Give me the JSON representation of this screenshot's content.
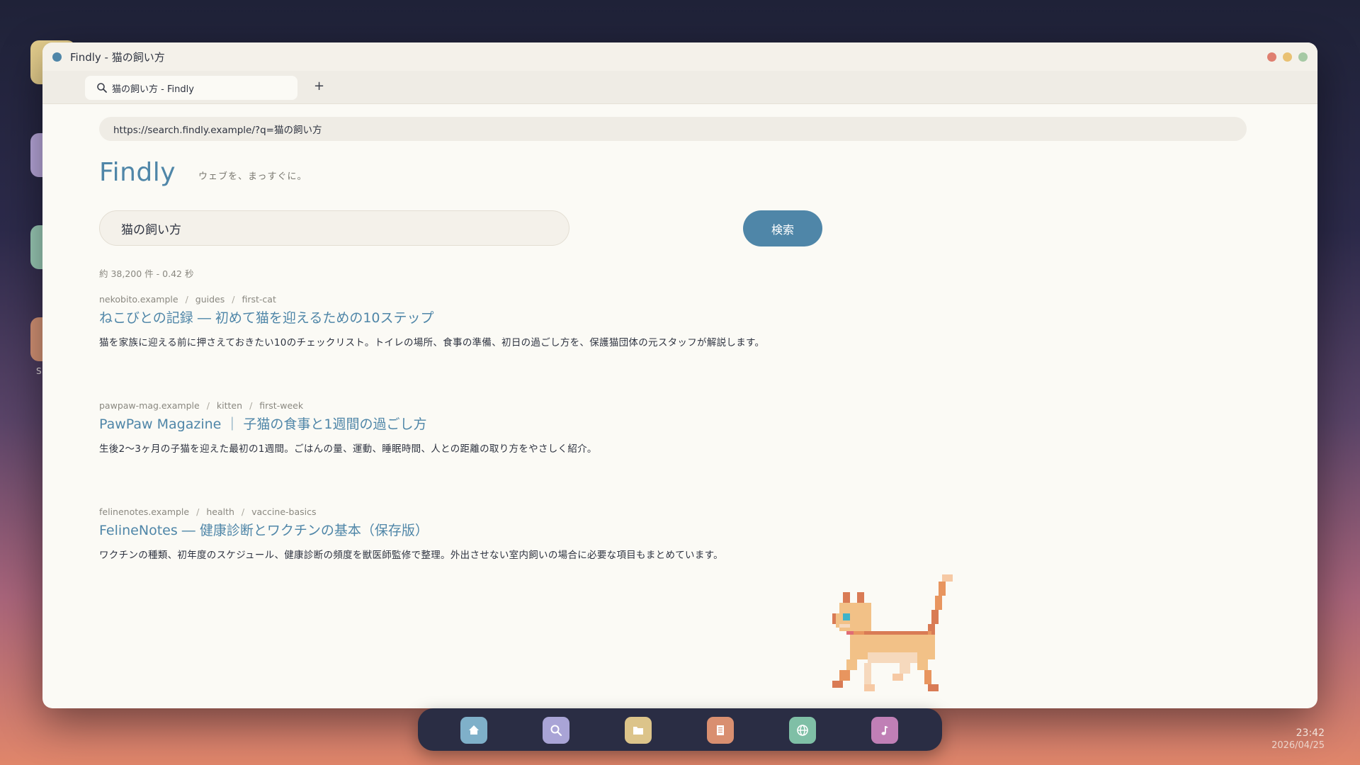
{
  "window": {
    "title": "Findly  -  猫の飼い方",
    "tab_label": "猫の飼い方  -  Findly",
    "new_tab": "+"
  },
  "address_bar": {
    "url": "https://search.findly.example/?q=猫の飼い方"
  },
  "brand": {
    "logo": "Findly",
    "tagline": "ウェブを、まっすぐに。"
  },
  "search": {
    "query": "猫の飼い方",
    "button_label": "検索"
  },
  "stats": "約 38,200 件  -  0.42 秒",
  "results": [
    {
      "crumbs": [
        "nekobito.example",
        "guides",
        "first-cat"
      ],
      "title": "ねこびとの記録 ― 初めて猫を迎えるための10ステップ",
      "desc": "猫を家族に迎える前に押さえておきたい10のチェックリスト。トイレの場所、食事の準備、初日の過ごし方を、保護猫団体の元スタッフが解説します。"
    },
    {
      "crumbs": [
        "pawpaw-mag.example",
        "kitten",
        "first-week"
      ],
      "title": "PawPaw Magazine ｜ 子猫の食事と1週間の過ごし方",
      "desc": "生後2〜3ヶ月の子猫を迎えた最初の1週間。ごはんの量、運動、睡眠時間、人との距離の取り方をやさしく紹介。"
    },
    {
      "crumbs": [
        "felinenotes.example",
        "health",
        "vaccine-basics"
      ],
      "title": "FelineNotes ― 健康診断とワクチンの基本（保存版）",
      "desc": "ワクチンの種類、初年度のスケジュール、健康診断の頻度を獣医師監修で整理。外出させない室内飼いの場合に必要な項目もまとめています。"
    }
  ],
  "dock": {
    "items": [
      {
        "icon": "home-icon",
        "color": "#7fb0c9"
      },
      {
        "icon": "search-icon",
        "color": "#a9a4d6"
      },
      {
        "icon": "folder-icon",
        "color": "#dcc48a"
      },
      {
        "icon": "document-icon",
        "color": "#d98f70"
      },
      {
        "icon": "globe-icon",
        "color": "#7fbfa6"
      },
      {
        "icon": "music-icon",
        "color": "#c07fb6"
      }
    ]
  },
  "clock": {
    "time": "23:42",
    "date": "2026/04/25"
  },
  "colors": {
    "accent": "#4f86a8",
    "window_bg": "#fbfaf5",
    "dock_bg": "#2a2d44"
  }
}
